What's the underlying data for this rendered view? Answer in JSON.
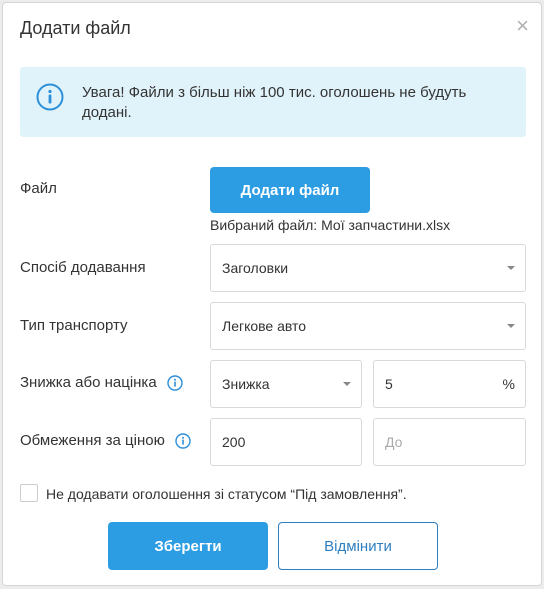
{
  "dialog": {
    "title": "Додати файл",
    "close_label": "×"
  },
  "alert": {
    "text": "Увага! Файли з більш ніж 100 тис. оголошень не будуть додані."
  },
  "file": {
    "label": "Файл",
    "button_label": "Додати файл",
    "selected_text": "Вибраний файл: Мої запчастини.xlsx"
  },
  "method": {
    "label": "Спосіб додавання",
    "value": "Заголовки"
  },
  "transport": {
    "label": "Тип транспорту",
    "value": "Легкове авто"
  },
  "discount": {
    "label": "Знижка або націнка",
    "type_value": "Знижка",
    "amount_value": "5",
    "suffix": "%"
  },
  "price_limit": {
    "label": "Обмеження за ціною",
    "from_value": "200",
    "to_placeholder": "До"
  },
  "checkbox": {
    "label": "Не додавати оголошення зі статусом “Під замовлення”."
  },
  "actions": {
    "save_label": "Зберегти",
    "cancel_label": "Відмінити"
  },
  "colors": {
    "accent": "#2d9de3",
    "alert_bg": "#e1f3fa",
    "info_icon": "#2d8fd8"
  }
}
